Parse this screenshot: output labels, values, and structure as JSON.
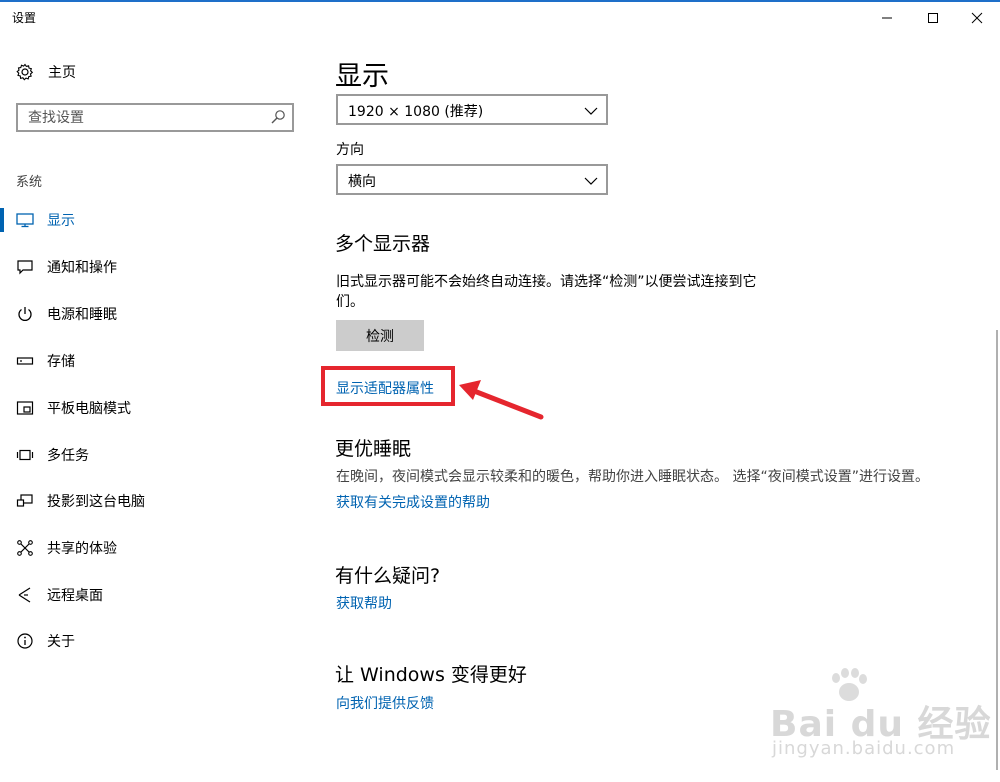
{
  "window": {
    "title": "设置"
  },
  "sidebar": {
    "home_label": "主页",
    "search_placeholder": "查找设置",
    "section_label": "系统",
    "items": [
      {
        "label": "显示",
        "icon": "monitor-icon",
        "active": true
      },
      {
        "label": "通知和操作",
        "icon": "notification-icon"
      },
      {
        "label": "电源和睡眠",
        "icon": "power-icon"
      },
      {
        "label": "存储",
        "icon": "storage-icon"
      },
      {
        "label": "平板电脑模式",
        "icon": "tablet-mode-icon"
      },
      {
        "label": "多任务",
        "icon": "multitasking-icon"
      },
      {
        "label": "投影到这台电脑",
        "icon": "projecting-icon"
      },
      {
        "label": "共享的体验",
        "icon": "shared-experiences-icon"
      },
      {
        "label": "远程桌面",
        "icon": "remote-desktop-icon"
      },
      {
        "label": "关于",
        "icon": "info-icon"
      }
    ]
  },
  "main": {
    "page_title": "显示",
    "resolution_value": "1920 × 1080 (推荐)",
    "orientation_label": "方向",
    "orientation_value": "横向",
    "multi_display": {
      "heading": "多个显示器",
      "description": "旧式显示器可能不会始终自动连接。请选择“检测”以便尝试连接到它们。",
      "detect_button": "检测",
      "adapter_link": "显示适配器属性"
    },
    "sleep": {
      "heading": "更优睡眠",
      "description": "在晚间，夜间模式会显示较柔和的暖色，帮助你进入睡眠状态。 选择“夜间模式设置”进行设置。",
      "help_link": "获取有关完成设置的帮助"
    },
    "questions": {
      "heading": "有什么疑问?",
      "link": "获取帮助"
    },
    "feedback": {
      "heading": "让 Windows 变得更好",
      "link": "向我们提供反馈"
    }
  },
  "annotation": {
    "color": "#e5262e"
  },
  "watermark": {
    "logo": "Bai du 经验",
    "url": "jingyan.baidu.com"
  },
  "colors": {
    "accent": "#0063b1",
    "titlebar_line": "#1e6fc9"
  }
}
